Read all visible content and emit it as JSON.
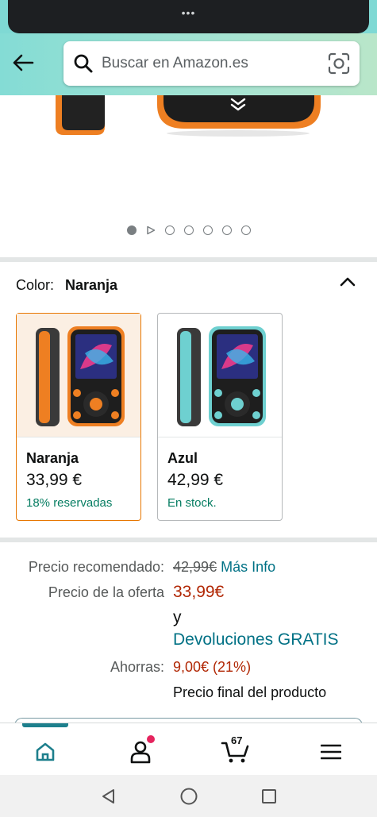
{
  "status": {
    "notch_dots": "•••"
  },
  "header": {
    "search_placeholder": "Buscar en Amazon.es"
  },
  "carousel": {
    "image_count": 7,
    "active_index": 0,
    "has_video": true
  },
  "colors": {
    "brand_teal": "#007185",
    "price_red": "#b12704",
    "stock_green": "#067d62",
    "selected_orange": "#e77600"
  },
  "color_selector": {
    "label": "Color:",
    "selected": "Naranja",
    "options": [
      {
        "name": "Naranja",
        "price": "33,99 €",
        "stock": "18% reservadas"
      },
      {
        "name": "Azul",
        "price": "42,99 €",
        "stock": "En stock."
      }
    ]
  },
  "price": {
    "recommended_label": "Precio recomendado:",
    "recommended_value": "42,99€",
    "more_info": "Más Info",
    "deal_label": "Precio de la oferta",
    "deal_value": "33,99€",
    "and": "y",
    "free_returns": "Devoluciones GRATIS",
    "savings_label": "Ahorras:",
    "savings_value": "9,00€ (21%)",
    "final_note": "Precio final del producto"
  },
  "bottom_nav": {
    "cart_count": "67",
    "items": [
      "home",
      "account",
      "cart",
      "menu"
    ]
  }
}
